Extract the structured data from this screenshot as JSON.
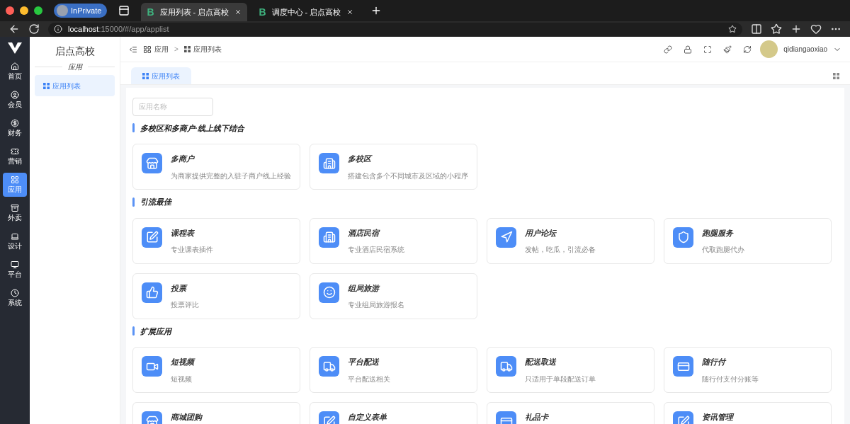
{
  "browser": {
    "profile": "InPrivate",
    "tabs": [
      {
        "site_letter": "B",
        "title": "应用列表 - 启点高校",
        "selected": true
      },
      {
        "site_letter": "B",
        "title": "调度中心 - 启点高校",
        "selected": false
      }
    ],
    "url_host": "localhost",
    "url_rest": ":15000/#/app/applist"
  },
  "rail": [
    {
      "label": "首页",
      "selected": false
    },
    {
      "label": "会员",
      "selected": false
    },
    {
      "label": "财务",
      "selected": false
    },
    {
      "label": "营销",
      "selected": false
    },
    {
      "label": "应用",
      "selected": true
    },
    {
      "label": "外卖",
      "selected": false
    },
    {
      "label": "设计",
      "selected": false
    },
    {
      "label": "平台",
      "selected": false
    },
    {
      "label": "系统",
      "selected": false
    }
  ],
  "sidebar": {
    "title": "启点高校",
    "section": "应用",
    "items": [
      {
        "label": "应用列表",
        "selected": true
      }
    ]
  },
  "breadcrumb": {
    "items": [
      "应用",
      "应用列表"
    ],
    "separator": ">"
  },
  "user": "qidiangaoxiao",
  "page_tabs": [
    {
      "label": "应用列表",
      "selected": true
    }
  ],
  "search": {
    "placeholder": "应用名称"
  },
  "groups": [
    {
      "title": "多校区和多商户·线上线下结合",
      "apps": [
        {
          "name": "多商户",
          "desc": "为商家提供完整的入驻子商户线上经验",
          "kind": "store"
        },
        {
          "name": "多校区",
          "desc": "搭建包含多个不同城市及区域的小程序",
          "kind": "building"
        }
      ]
    },
    {
      "title": "引流最佳",
      "apps": [
        {
          "name": "课程表",
          "desc": "专业课表插件",
          "kind": "edit"
        },
        {
          "name": "酒店民宿",
          "desc": "专业酒店民宿系统",
          "kind": "building"
        },
        {
          "name": "用户论坛",
          "desc": "发帖，吃瓜，引流必备",
          "kind": "navigation"
        },
        {
          "name": "跑腿服务",
          "desc": "代取跑腿代办",
          "kind": "shield"
        },
        {
          "name": "投票",
          "desc": "投票评比",
          "kind": "thumb"
        },
        {
          "name": "组局旅游",
          "desc": "专业组局旅游报名",
          "kind": "smile"
        }
      ]
    },
    {
      "title": "扩展应用",
      "apps": [
        {
          "name": "短视频",
          "desc": "短视频",
          "kind": "video"
        },
        {
          "name": "平台配送",
          "desc": "平台配送相关",
          "kind": "truck"
        },
        {
          "name": "配送取送",
          "desc": "只适用于单段配送订单",
          "kind": "truck"
        },
        {
          "name": "随行付",
          "desc": "随行付支付分账等",
          "kind": "card"
        },
        {
          "name": "商城团购",
          "kind": "store"
        },
        {
          "name": "自定义表单",
          "kind": "edit"
        },
        {
          "name": "礼品卡",
          "kind": "card"
        },
        {
          "name": "资讯管理",
          "kind": "edit"
        }
      ]
    }
  ]
}
